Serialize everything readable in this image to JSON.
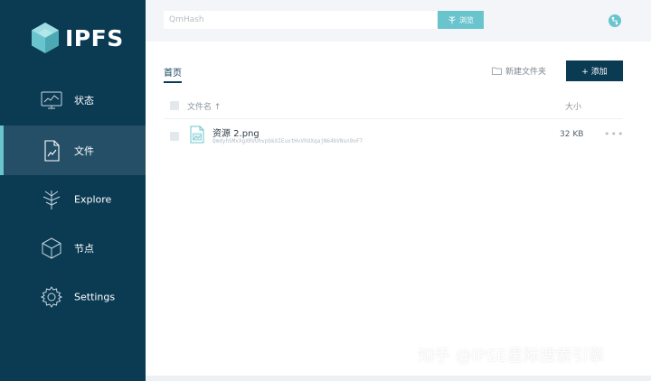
{
  "app": {
    "logo_text": "IPFS"
  },
  "sidebar": {
    "items": [
      {
        "label": "状态",
        "icon": "status-monitor-icon"
      },
      {
        "label": "文件",
        "icon": "file-document-icon"
      },
      {
        "label": "Explore",
        "icon": "explore-tree-icon"
      },
      {
        "label": "节点",
        "icon": "peers-cube-icon"
      },
      {
        "label": "Settings",
        "icon": "settings-gear-icon"
      }
    ]
  },
  "topbar": {
    "search_placeholder": "QmHash",
    "browse_label": "浏览"
  },
  "main": {
    "breadcrumb": "首页",
    "new_folder_label": "新建文件夹",
    "add_label": "+ 添加",
    "table": {
      "col_name": "文件名 ↑",
      "col_size": "大小",
      "rows": [
        {
          "name": "资源 2.png",
          "hash": "QmdyhSMxXgXRVUhvpbkXIEuxtHvVhUXqajN64bVNsn9oF7",
          "size": "32 KB",
          "more": "•••"
        }
      ]
    }
  },
  "watermark": "知乎 @IPSE星际搜索引擎",
  "colors": {
    "sidebar": "#0b3a53",
    "accent": "#69c4cd",
    "active": "#244f67"
  }
}
